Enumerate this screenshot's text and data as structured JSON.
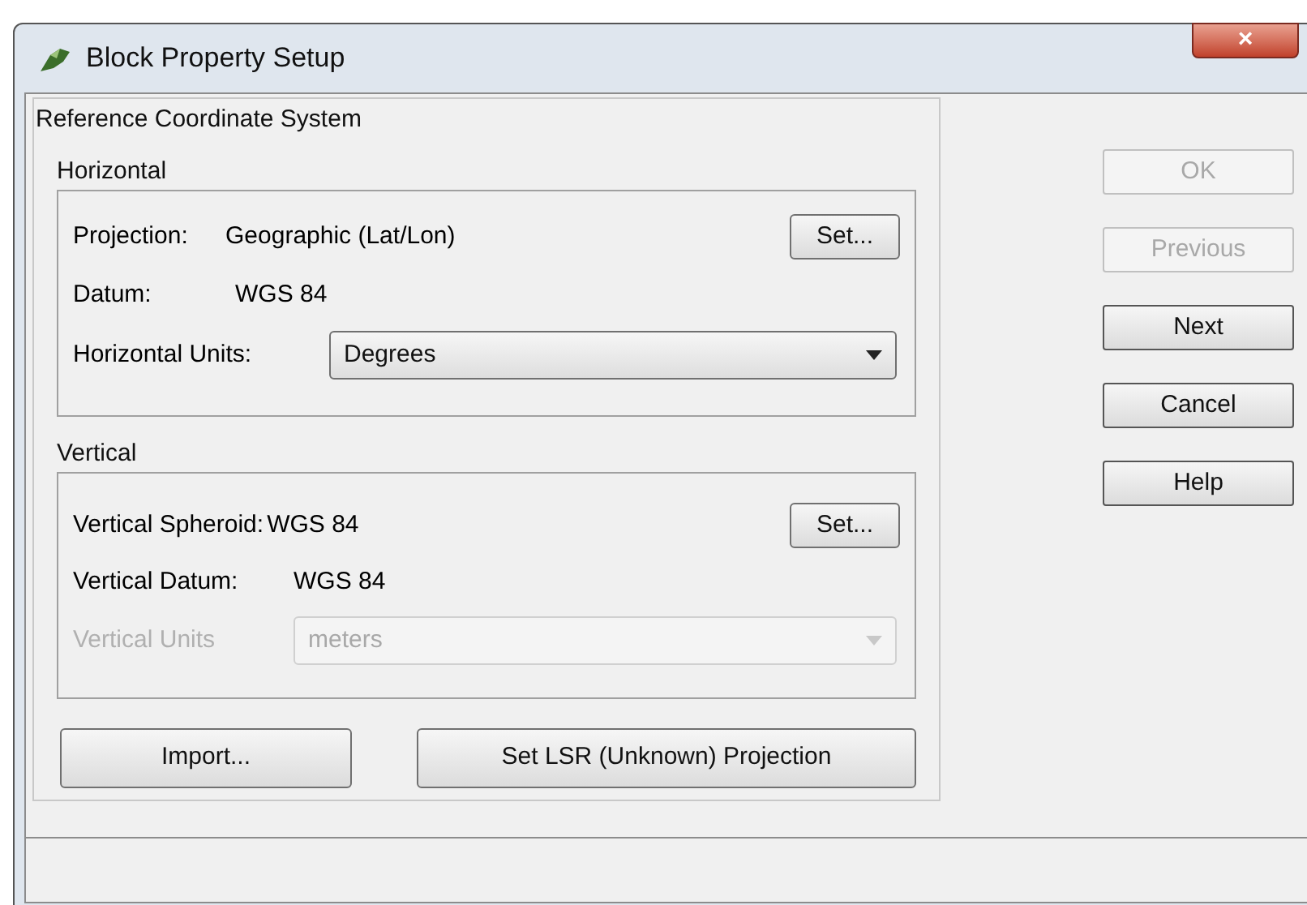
{
  "window": {
    "title": "Block Property Setup",
    "close": "×"
  },
  "reference_group": {
    "label": "Reference Coordinate System",
    "horizontal": {
      "label": "Horizontal",
      "projection_label": "Projection:",
      "projection_value": "Geographic (Lat/Lon)",
      "set_button": "Set...",
      "datum_label": "Datum:",
      "datum_value": "WGS 84",
      "units_label": "Horizontal Units:",
      "units_value": "Degrees",
      "units_disabled": false
    },
    "vertical": {
      "label": "Vertical",
      "spheroid_label": "Vertical Spheroid:",
      "spheroid_value": "WGS 84",
      "set_button": "Set...",
      "datum_label": "Vertical Datum:",
      "datum_value": "WGS 84",
      "units_label": "Vertical Units",
      "units_value": "meters",
      "units_disabled": true
    },
    "import_button": "Import...",
    "lsr_button": "Set LSR (Unknown) Projection"
  },
  "side_buttons": [
    {
      "label": "OK",
      "disabled": true
    },
    {
      "label": "Previous",
      "disabled": true
    },
    {
      "label": "Next",
      "disabled": false
    },
    {
      "label": "Cancel",
      "disabled": false
    },
    {
      "label": "Help",
      "disabled": false
    }
  ]
}
